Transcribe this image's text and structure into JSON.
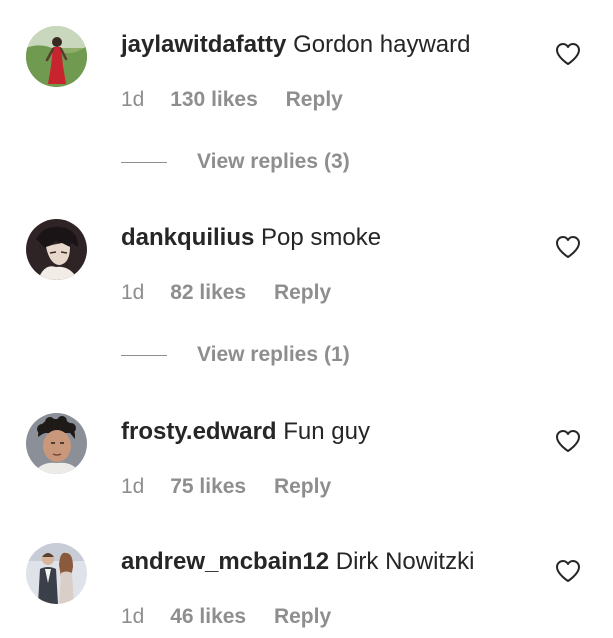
{
  "comments": [
    {
      "username": "jaylawitdafatty",
      "text": "Gordon hayward",
      "time": "1d",
      "likes": "130 likes",
      "reply": "Reply",
      "view_replies": {
        "label": "View replies",
        "count": "(3)"
      },
      "avatar_icon": "avatar-person-red-dress",
      "heart_icon": "heart-outline-icon"
    },
    {
      "username": "dankquilius",
      "text": "Pop smoke",
      "time": "1d",
      "likes": "82 likes",
      "reply": "Reply",
      "view_replies": {
        "label": "View replies",
        "count": "(1)"
      },
      "avatar_icon": "avatar-anime-character",
      "heart_icon": "heart-outline-icon"
    },
    {
      "username": "frosty.edward",
      "text": "Fun guy",
      "time": "1d",
      "likes": "75 likes",
      "reply": "Reply",
      "avatar_icon": "avatar-man-curly-hair",
      "heart_icon": "heart-outline-icon"
    },
    {
      "username": "andrew_mcbain12",
      "text": "Dirk Nowitzki",
      "time": "1d",
      "likes": "46 likes",
      "reply": "Reply",
      "avatar_icon": "avatar-couple-photo",
      "heart_icon": "heart-outline-icon"
    }
  ],
  "colors": {
    "primary_text": "#262626",
    "secondary_text": "#8e8e8e",
    "background": "#ffffff"
  }
}
